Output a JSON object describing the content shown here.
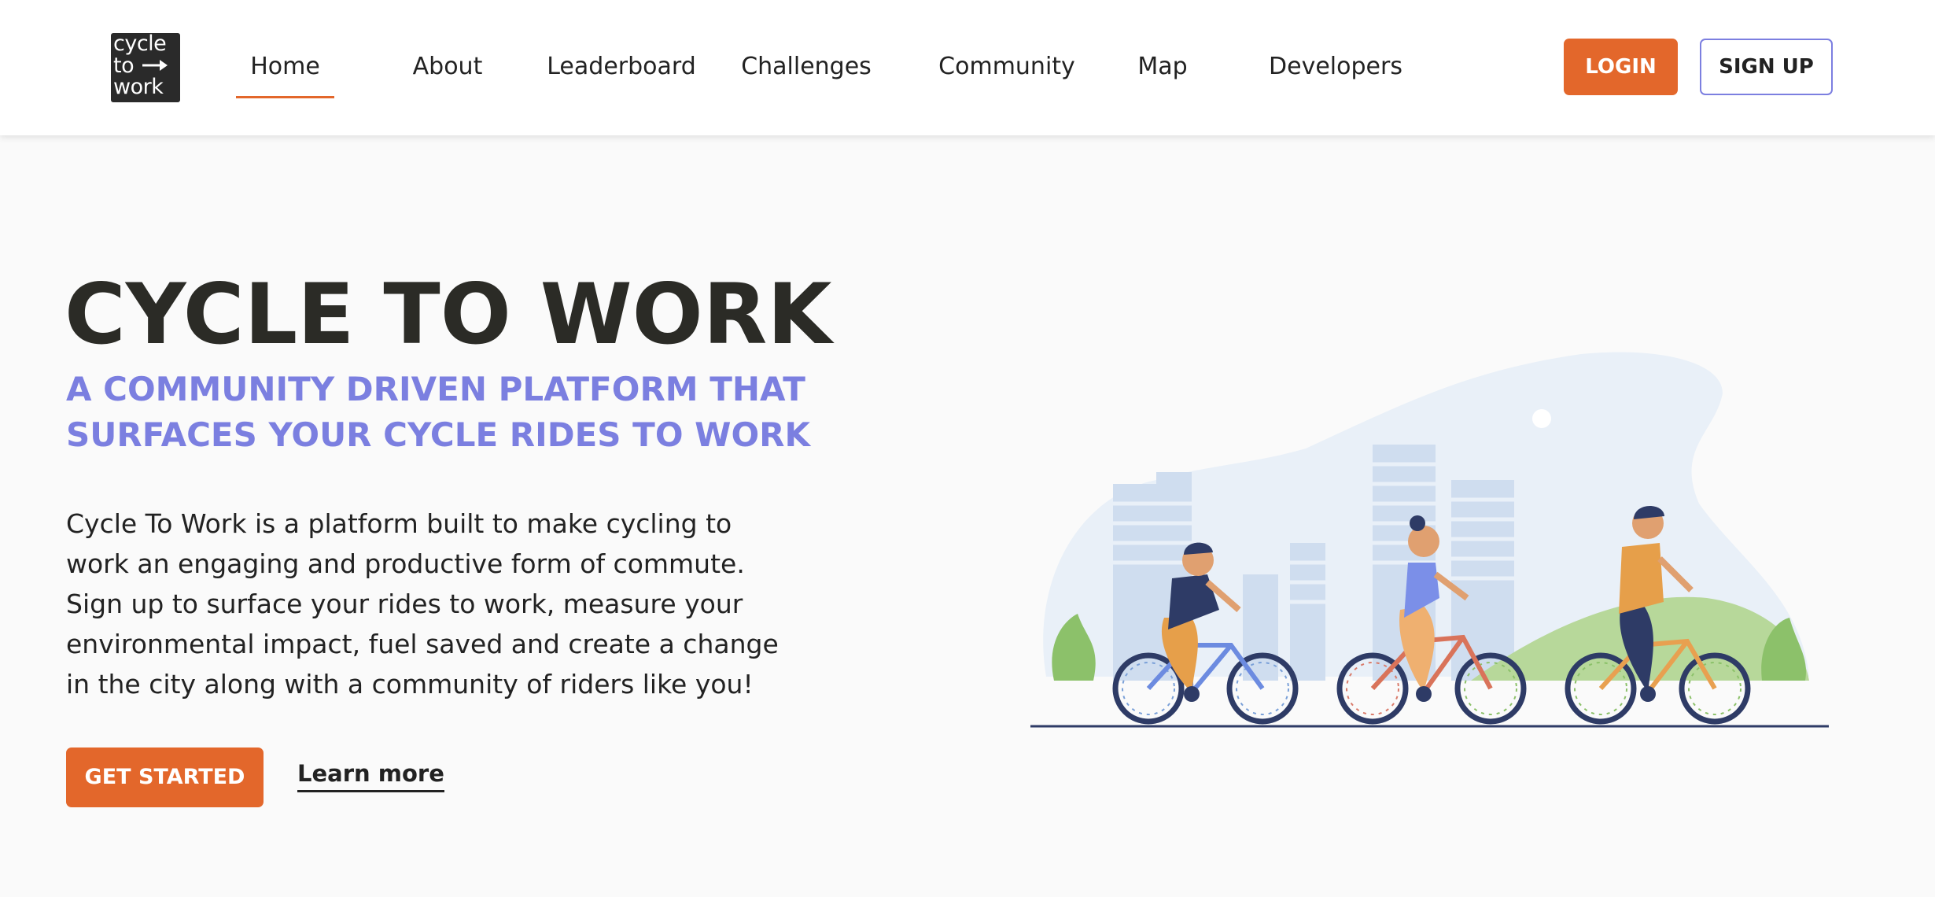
{
  "header": {
    "logo": {
      "line1": "cycle",
      "line2": "to",
      "line3": "work"
    },
    "nav": [
      {
        "label": "Home",
        "active": true
      },
      {
        "label": "About",
        "active": false
      },
      {
        "label": "Leaderboard",
        "active": false
      },
      {
        "label": "Challenges",
        "active": false
      },
      {
        "label": "Community",
        "active": false
      },
      {
        "label": "Map",
        "active": false
      },
      {
        "label": "Developers",
        "active": false
      }
    ],
    "login_label": "LOGIN",
    "signup_label": "SIGN UP"
  },
  "hero": {
    "title": "CYCLE TO WORK",
    "subtitle": "A COMMUNITY DRIVEN PLATFORM THAT SURFACES YOUR CYCLE RIDES TO WORK",
    "body": "Cycle To Work is a platform built to make cycling to work an engaging and productive form of commute. Sign up to surface your rides to work, measure your environmental impact, fuel saved and create a change in the city along with a community of riders like you!",
    "cta_label": "GET STARTED",
    "learn_more_label": "Learn more"
  },
  "colors": {
    "accent": "#e3672b",
    "brand_purple": "#7b7fe0",
    "text_dark": "#2b2b26",
    "background": "#fafafa"
  },
  "icons": {
    "logo": "cycle-to-work-logo",
    "illustration": "three-cyclists-city-illustration"
  }
}
